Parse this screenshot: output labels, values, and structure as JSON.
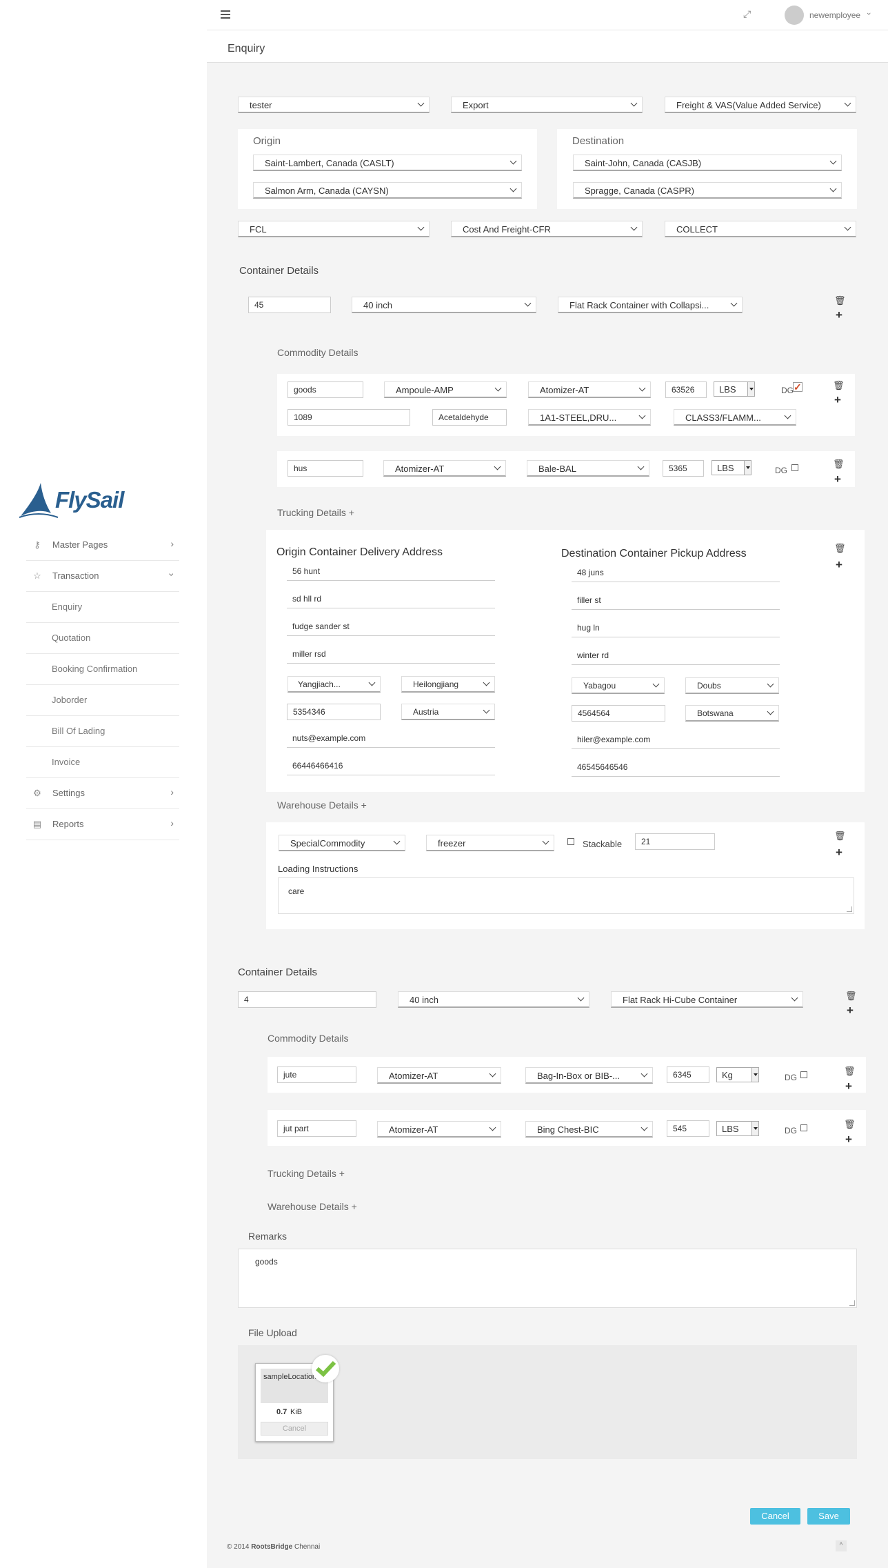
{
  "sidebar": {
    "logo_text": "FlySail",
    "items": [
      {
        "label": "Master Pages"
      },
      {
        "label": "Transaction"
      },
      {
        "label": "Enquiry"
      },
      {
        "label": "Quotation"
      },
      {
        "label": "Booking Confirmation"
      },
      {
        "label": "Joborder"
      },
      {
        "label": "Bill Of Lading"
      },
      {
        "label": "Invoice"
      },
      {
        "label": "Settings"
      },
      {
        "label": "Reports"
      }
    ]
  },
  "topbar": {
    "username": "newemployee"
  },
  "page": {
    "title": "Enquiry"
  },
  "form": {
    "customer": "tester",
    "direction": "Export",
    "service": "Freight & VAS(Value Added Service)",
    "origin_label": "Origin",
    "origin_port_1": "Saint-Lambert, Canada (CASLT)",
    "origin_port_2": "Salmon Arm, Canada (CAYSN)",
    "destination_label": "Destination",
    "dest_port_1": "Saint-John, Canada (CASJB)",
    "dest_port_2": "Spragge, Canada (CASPR)",
    "load_type": "FCL",
    "incoterm": "Cost And Freight-CFR",
    "payment": "COLLECT"
  },
  "labels": {
    "container_details": "Container Details",
    "commodity_details": "Commodity Details",
    "trucking_details": "Trucking Details +",
    "warehouse_details": "Warehouse Details +",
    "origin_address": "Origin Container Delivery Address",
    "dest_address": "Destination Container Pickup Address",
    "loading_instructions": "Loading Instructions",
    "stackable": "Stackable",
    "dg": "DG",
    "remarks": "Remarks",
    "file_upload": "File Upload"
  },
  "container1": {
    "qty": "45",
    "size": "40 inch",
    "type": "Flat Rack Container with Collapsi...",
    "commodity1": {
      "name": "goods",
      "pkg": "Ampoule-AMP",
      "pkg2": "Atomizer-AT",
      "weight": "63526",
      "unit": "LBS",
      "un": "1089",
      "chem": "Acetaldehyde",
      "packing": "1A1-STEEL,DRU...",
      "class": "CLASS3/FLAMM..."
    },
    "commodity2": {
      "name": "hus",
      "pkg": "Atomizer-AT",
      "pkg2": "Bale-BAL",
      "weight": "5365",
      "unit": "LBS"
    },
    "origin_addr": {
      "line1": "56 hunt",
      "line2": "sd hll rd",
      "line3": "fudge sander st",
      "line4": "miller rsd",
      "city": "Yangjiach...",
      "state": "Heilongjiang",
      "zip": "5354346",
      "country": "Austria",
      "email": "nuts@example.com",
      "phone": "66446466416"
    },
    "dest_addr": {
      "line1": "48 juns",
      "line2": "filler st",
      "line3": "hug ln",
      "line4": "winter rd",
      "city": "Yabagou",
      "state": "Doubs",
      "zip": "4564564",
      "country": "Botswana",
      "email": "hiler@example.com",
      "phone": "46545646546"
    },
    "warehouse": {
      "commodity": "SpecialCommodity",
      "storage": "freezer",
      "count": "21",
      "instructions": "care"
    }
  },
  "container2": {
    "qty": "4",
    "size": "40 inch",
    "type": "Flat Rack Hi-Cube Container",
    "commodity1": {
      "name": "jute",
      "pkg": "Atomizer-AT",
      "pkg2": "Bag-In-Box or BIB-...",
      "weight": "6345",
      "unit": "Kg"
    },
    "commodity2": {
      "name": "jut part",
      "pkg": "Atomizer-AT",
      "pkg2": "Bing Chest-BIC",
      "weight": "545",
      "unit": "LBS"
    }
  },
  "remarks": {
    "text": "goods"
  },
  "upload": {
    "filename": "sampleLocation",
    "size_num": "0.7",
    "size_unit": "KiB",
    "cancel": "Cancel"
  },
  "actions": {
    "cancel": "Cancel",
    "save": "Save"
  },
  "footer": {
    "copyright": "© 2014",
    "brand": "RootsBridge",
    "city": "Chennai"
  }
}
